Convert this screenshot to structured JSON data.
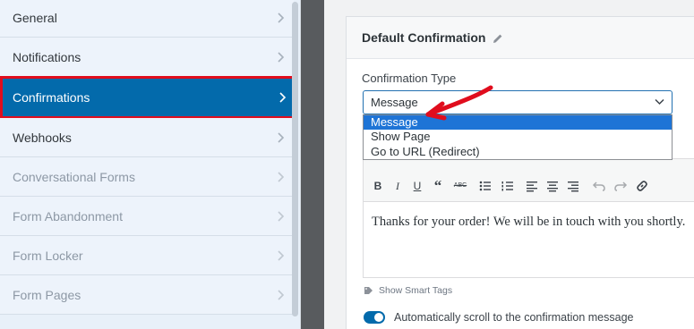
{
  "sidebar": {
    "items": [
      {
        "label": "General",
        "active": false,
        "disabled": false
      },
      {
        "label": "Notifications",
        "active": false,
        "disabled": false
      },
      {
        "label": "Confirmations",
        "active": true,
        "disabled": false
      },
      {
        "label": "Webhooks",
        "active": false,
        "disabled": false
      },
      {
        "label": "Conversational Forms",
        "active": false,
        "disabled": true
      },
      {
        "label": "Form Abandonment",
        "active": false,
        "disabled": true
      },
      {
        "label": "Form Locker",
        "active": false,
        "disabled": true
      },
      {
        "label": "Form Pages",
        "active": false,
        "disabled": true
      }
    ]
  },
  "card": {
    "title": "Default Confirmation",
    "confirmation_type_label": "Confirmation Type",
    "select_value": "Message",
    "options": [
      "Message",
      "Show Page",
      "Go to URL (Redirect)"
    ],
    "selected_option": "Message",
    "editor_text": "Thanks for your order! We will be in touch with you shortly.",
    "smart_tags_label": "Show Smart Tags",
    "auto_scroll_label": "Automatically scroll to the confirmation message",
    "auto_scroll_on": true
  },
  "toolbar": [
    "bold-icon",
    "italic-icon",
    "underline-icon",
    "blockquote-icon",
    "strikethrough-icon",
    "bullet-list-icon",
    "numbered-list-icon",
    "align-left-icon",
    "align-center-icon",
    "align-right-icon",
    "undo-icon",
    "redo-icon",
    "link-icon"
  ],
  "colors": {
    "active_item": "#036aab",
    "highlight_border": "#e00d1d",
    "dropdown_selected": "#1e74d6",
    "arrow": "#e00d1d"
  }
}
